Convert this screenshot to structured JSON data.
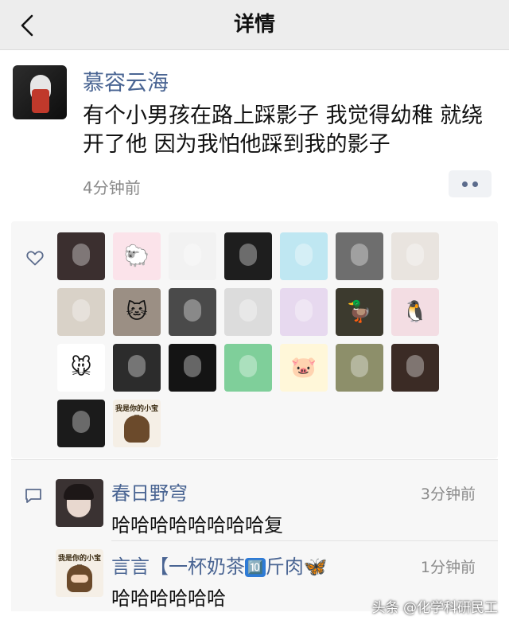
{
  "header": {
    "title": "详情",
    "back_icon": "chevron-left-icon"
  },
  "post": {
    "username": "慕容云海",
    "content": "有个小男孩在路上踩影子 我觉得幼稚 就绕开了他 因为我怕他踩到我的影子",
    "time": "4分钟前",
    "more_icon": "more-dots-icon"
  },
  "likes": {
    "icon": "heart-icon",
    "avatars": [
      {
        "name": "like-avatar-1",
        "bg": "#3b2f2f",
        "glyph": ""
      },
      {
        "name": "like-avatar-2",
        "bg": "#fbe3ea",
        "glyph": "🐑"
      },
      {
        "name": "like-avatar-3",
        "bg": "#f2f2f2",
        "glyph": ""
      },
      {
        "name": "like-avatar-4",
        "bg": "#1e1e1e",
        "glyph": ""
      },
      {
        "name": "like-avatar-5",
        "bg": "#bfe7f2",
        "glyph": ""
      },
      {
        "name": "like-avatar-6",
        "bg": "#6e6e6e",
        "glyph": ""
      },
      {
        "name": "like-avatar-7",
        "bg": "#e9e4df",
        "glyph": ""
      },
      {
        "name": "like-avatar-8",
        "bg": "#d9d2c8",
        "glyph": ""
      },
      {
        "name": "like-avatar-9",
        "bg": "#9b8f84",
        "glyph": "🐱"
      },
      {
        "name": "like-avatar-10",
        "bg": "#4a4a4a",
        "glyph": ""
      },
      {
        "name": "like-avatar-11",
        "bg": "#dcdcdc",
        "glyph": ""
      },
      {
        "name": "like-avatar-12",
        "bg": "#e7d9ef",
        "glyph": ""
      },
      {
        "name": "like-avatar-13",
        "bg": "#3c3a2e",
        "glyph": "🦆"
      },
      {
        "name": "like-avatar-14",
        "bg": "#f3dde3",
        "glyph": "🐧"
      },
      {
        "name": "like-avatar-15",
        "bg": "#ffffff",
        "glyph": "🐭"
      },
      {
        "name": "like-avatar-16",
        "bg": "#2c2c2c",
        "glyph": ""
      },
      {
        "name": "like-avatar-17",
        "bg": "#141414",
        "glyph": ""
      },
      {
        "name": "like-avatar-18",
        "bg": "#7fcf9a",
        "glyph": ""
      },
      {
        "name": "like-avatar-19",
        "bg": "#fff7d9",
        "glyph": "🐷"
      },
      {
        "name": "like-avatar-20",
        "bg": "#8d8f6a",
        "glyph": ""
      },
      {
        "name": "like-avatar-21",
        "bg": "#3b2b25",
        "glyph": ""
      },
      {
        "name": "like-avatar-22",
        "bg": "#1b1b1b",
        "glyph": ""
      },
      {
        "name": "like-avatar-23",
        "bg": "#f5efe6",
        "glyph": "",
        "label": "我是你的小宝贝"
      }
    ]
  },
  "comments": {
    "icon": "comment-icon",
    "items": [
      {
        "name": "春日野穹",
        "text": "哈哈哈哈哈哈哈哈复",
        "time": "3分钟前",
        "avatar_bg": "#3a3232"
      },
      {
        "name_prefix": "言言【一杯奶茶",
        "badge": "🔟",
        "name_suffix": "斤肉",
        "emoji": "🦋",
        "text": "哈哈哈哈哈哈",
        "time": "1分钟前",
        "avatar_bg": "#f5efe6",
        "avatar_label": "我是你的小宝贝"
      }
    ]
  },
  "watermark": "头条 @化学科研民工"
}
